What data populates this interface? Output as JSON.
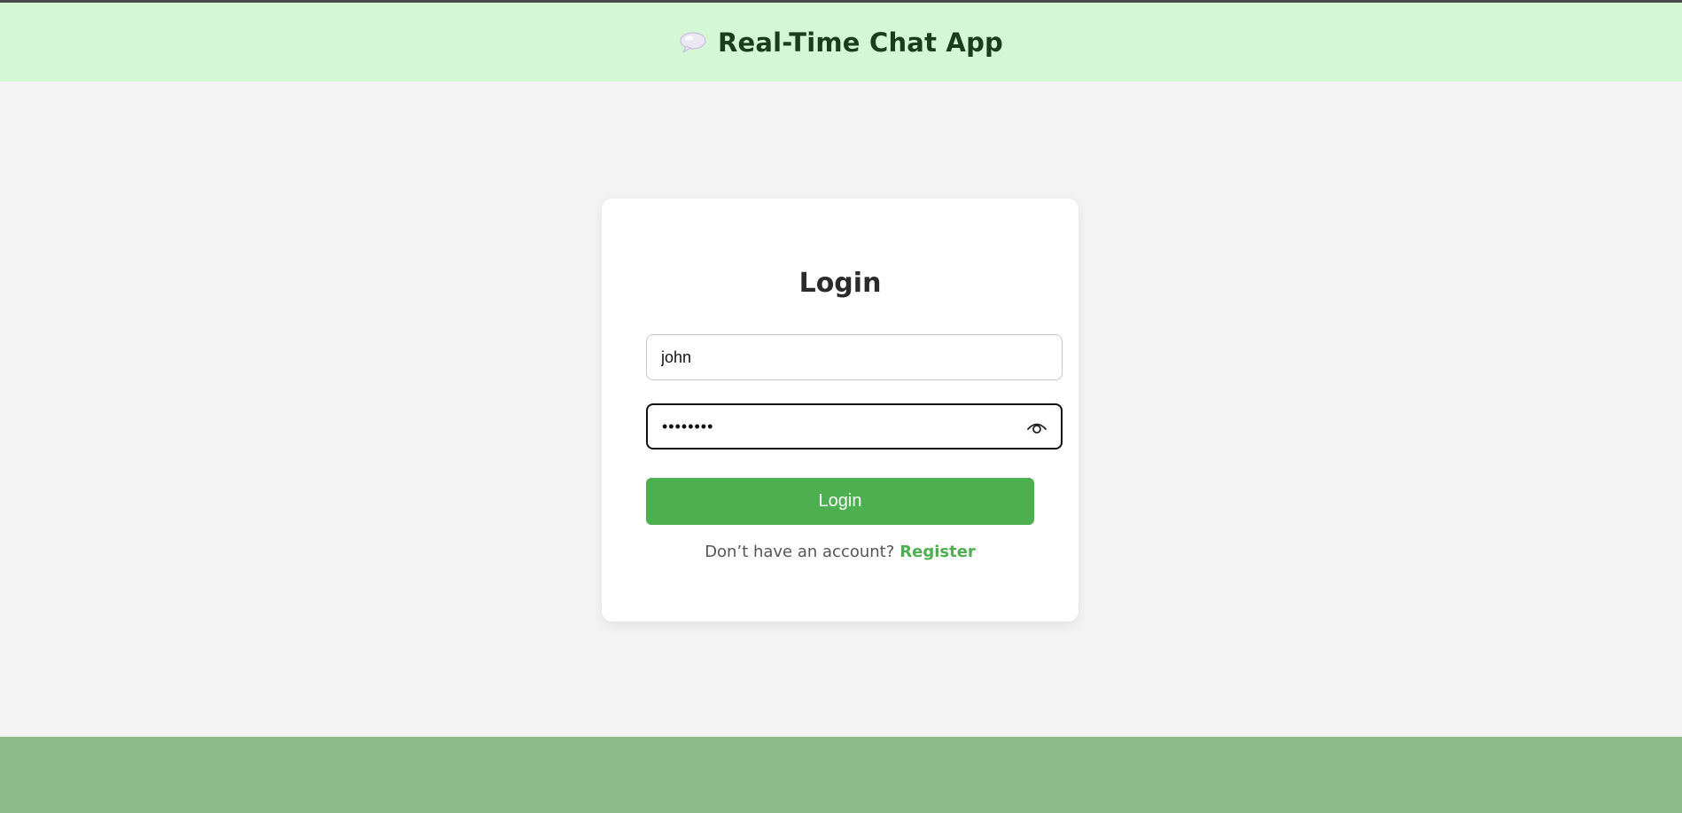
{
  "header": {
    "icon": "speech-bubble-icon",
    "title": "Real-Time Chat App"
  },
  "login_card": {
    "title": "Login",
    "username": {
      "value": "john",
      "placeholder": ""
    },
    "password": {
      "value": "password",
      "placeholder": "",
      "toggle_icon": "eye-icon"
    },
    "submit_label": "Login",
    "register_prompt": "Don’t have an account?",
    "register_link_label": "Register"
  },
  "colors": {
    "header_bg": "#d4f7d4",
    "page_bg": "#f3f3f3",
    "accent": "#4caf50",
    "footer_bg": "#8fbc8b"
  }
}
